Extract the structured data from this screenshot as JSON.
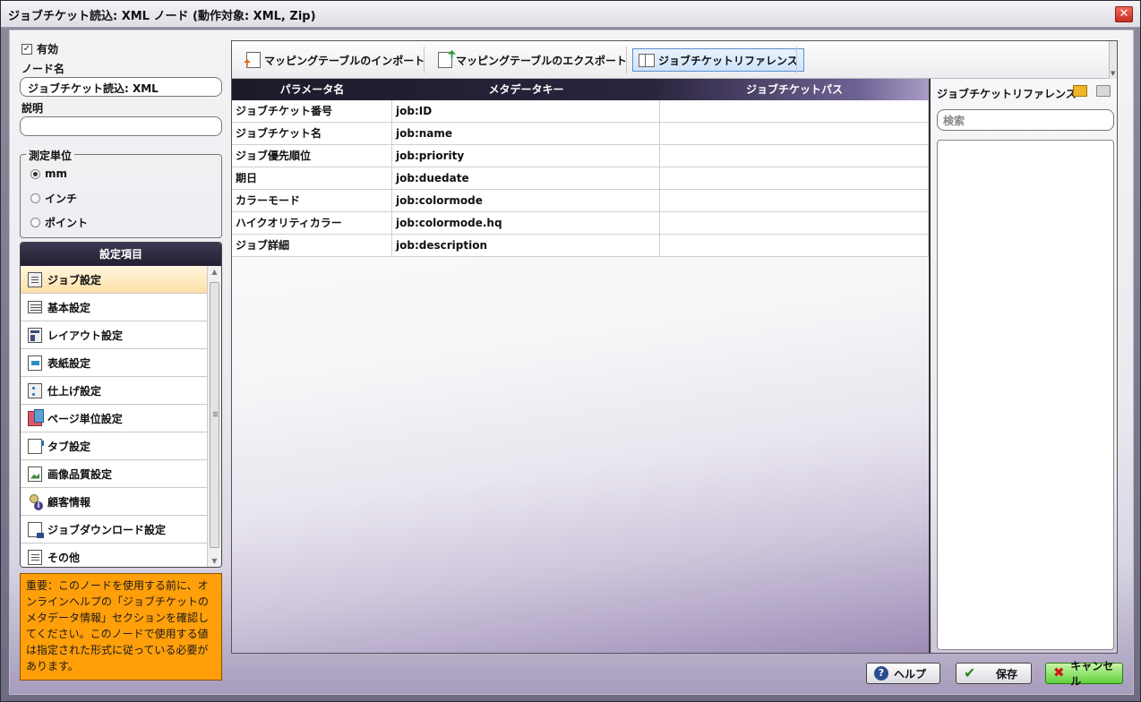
{
  "window": {
    "title": "ジョブチケット読込: XML ノード (動作対象: XML, Zip)",
    "close_glyph": "✕"
  },
  "left": {
    "enabled_label": "有効",
    "enabled_checked": true,
    "node_name_label": "ノード名",
    "node_name_value": "ジョブチケット読込: XML",
    "description_label": "説明",
    "description_value": "",
    "unit_group_label": "測定単位",
    "units": [
      {
        "label": "mm",
        "selected": true
      },
      {
        "label": "インチ",
        "selected": false
      },
      {
        "label": "ポイント",
        "selected": false
      }
    ],
    "settings_header": "設定項目",
    "settings_items": [
      {
        "label": "ジョブ設定",
        "icon": "job-settings-icon",
        "selected": true
      },
      {
        "label": "基本設定",
        "icon": "basic-settings-icon"
      },
      {
        "label": "レイアウト設定",
        "icon": "layout-icon"
      },
      {
        "label": "表紙設定",
        "icon": "cover-icon"
      },
      {
        "label": "仕上げ設定",
        "icon": "finishing-icon"
      },
      {
        "label": "ページ単位設定",
        "icon": "page-settings-icon"
      },
      {
        "label": "タブ設定",
        "icon": "tab-icon"
      },
      {
        "label": "画像品質設定",
        "icon": "image-quality-icon"
      },
      {
        "label": "顧客情報",
        "icon": "customer-info-icon"
      },
      {
        "label": "ジョブダウンロード設定",
        "icon": "job-download-icon"
      },
      {
        "label": "その他",
        "icon": "other-icon"
      }
    ],
    "notice": "重要：このノードを使用する前に、オンラインヘルプの「ジョブチケットのメタデータ情報」セクションを確認してください。このノードで使用する値は指定された形式に従っている必要があります。"
  },
  "toolbar": {
    "import_label": "マッピングテーブルのインポート",
    "export_label": "マッピングテーブルのエクスポート",
    "reference_label": "ジョブチケットリファレンス"
  },
  "table": {
    "columns": [
      "パラメータ名",
      "メタデータキー",
      "ジョブチケットパス"
    ],
    "rows": [
      [
        "ジョブチケット番号",
        "job:ID",
        ""
      ],
      [
        "ジョブチケット名",
        "job:name",
        ""
      ],
      [
        "ジョブ優先順位",
        "job:priority",
        ""
      ],
      [
        "期日",
        "job:duedate",
        ""
      ],
      [
        "カラーモード",
        "job:colormode",
        ""
      ],
      [
        "ハイクオリティカラー",
        "job:colormode.hq",
        ""
      ],
      [
        "ジョブ詳細",
        "job:description",
        ""
      ]
    ]
  },
  "reference_panel": {
    "title": "ジョブチケットリファレンス",
    "search_placeholder": "検索"
  },
  "buttons": {
    "help": "ヘルプ",
    "save": "保存",
    "cancel": "キャンセル"
  },
  "colors": {
    "notice_bg": "#ff9f0a",
    "header_dark": "#251f33",
    "selected_item": "#fde0a8",
    "accent_purple": "#9c8cb6"
  }
}
